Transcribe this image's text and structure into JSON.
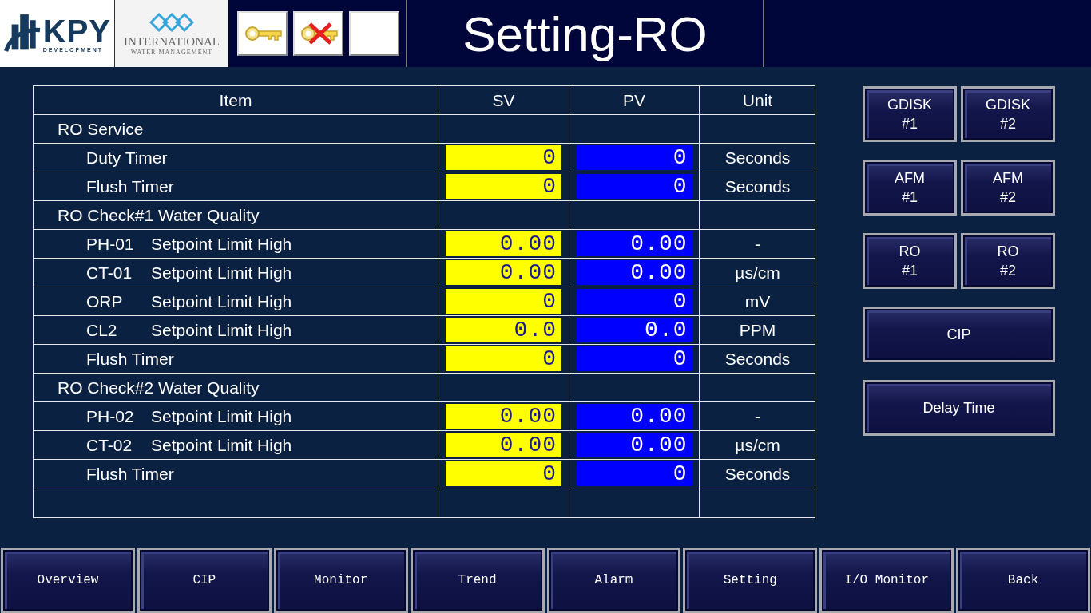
{
  "header": {
    "company_logo": {
      "name": "KPY",
      "tagline": "DEVELOPMENT"
    },
    "partner_logo": {
      "name": "INTERNATIONAL",
      "tagline": "WATER MANAGEMENT"
    },
    "tools": [
      {
        "kind": "key"
      },
      {
        "kind": "key-cancel"
      },
      {
        "kind": "blank"
      }
    ],
    "title": "Setting-RO"
  },
  "table": {
    "columns": [
      "Item",
      "SV",
      "PV",
      "Unit"
    ],
    "rows": [
      {
        "kind": "group",
        "label": "RO Service"
      },
      {
        "kind": "param",
        "label": "Duty Timer",
        "sv": "0",
        "pv": "0",
        "unit": "Seconds"
      },
      {
        "kind": "param",
        "label": "Flush Timer",
        "sv": "0",
        "pv": "0",
        "unit": "Seconds"
      },
      {
        "kind": "group",
        "label": "RO Check#1 Water Quality"
      },
      {
        "kind": "param",
        "tag": "PH-01",
        "label": "Setpoint Limit High",
        "sv": "0.00",
        "pv": "0.00",
        "unit": "-"
      },
      {
        "kind": "param",
        "tag": "CT-01",
        "label": "Setpoint Limit High",
        "sv": "0.00",
        "pv": "0.00",
        "unit": "µs/cm"
      },
      {
        "kind": "param",
        "tag": "ORP",
        "label": "Setpoint Limit High",
        "sv": "0",
        "pv": "0",
        "unit": "mV"
      },
      {
        "kind": "param",
        "tag": "CL2",
        "label": "Setpoint Limit High",
        "sv": "0.0",
        "pv": "0.0",
        "unit": "PPM"
      },
      {
        "kind": "param",
        "label": "Flush Timer",
        "sv": "0",
        "pv": "0",
        "unit": "Seconds"
      },
      {
        "kind": "group",
        "label": "RO Check#2 Water Quality"
      },
      {
        "kind": "param",
        "tag": "PH-02",
        "label": "Setpoint Limit High",
        "sv": "0.00",
        "pv": "0.00",
        "unit": "-"
      },
      {
        "kind": "param",
        "tag": "CT-02",
        "label": "Setpoint Limit High",
        "sv": "0.00",
        "pv": "0.00",
        "unit": "µs/cm"
      },
      {
        "kind": "param",
        "label": "Flush Timer",
        "sv": "0",
        "pv": "0",
        "unit": "Seconds"
      },
      {
        "kind": "blank"
      }
    ]
  },
  "side_buttons": [
    {
      "kind": "half",
      "lines": [
        "GDISK",
        "#1"
      ]
    },
    {
      "kind": "half",
      "lines": [
        "GDISK",
        "#2"
      ]
    },
    {
      "kind": "half",
      "lines": [
        "AFM",
        "#1"
      ]
    },
    {
      "kind": "half",
      "lines": [
        "AFM",
        "#2"
      ]
    },
    {
      "kind": "half",
      "lines": [
        "RO",
        "#1"
      ]
    },
    {
      "kind": "half",
      "lines": [
        "RO",
        "#2"
      ]
    },
    {
      "kind": "full",
      "lines": [
        "CIP"
      ]
    },
    {
      "kind": "full",
      "lines": [
        "Delay Time"
      ]
    }
  ],
  "nav": [
    "Overview",
    "CIP",
    "Monitor",
    "Trend",
    "Alarm",
    "Setting",
    "I/O Monitor",
    "Back"
  ]
}
